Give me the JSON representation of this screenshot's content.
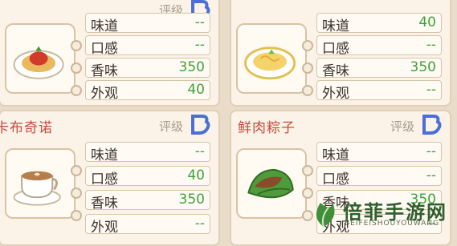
{
  "cards": [
    {
      "name": "",
      "rating_label": "评级",
      "stats": [
        {
          "label": "味道",
          "value": "--"
        },
        {
          "label": "口感",
          "value": "--"
        },
        {
          "label": "香味",
          "value": "350"
        },
        {
          "label": "外观",
          "value": "40"
        }
      ],
      "dish_icon": "spaghetti-dish-icon"
    },
    {
      "name": "",
      "rating_label": "",
      "stats": [
        {
          "label": "味道",
          "value": "40"
        },
        {
          "label": "口感",
          "value": "--"
        },
        {
          "label": "香味",
          "value": "350"
        },
        {
          "label": "外观",
          "value": "--"
        }
      ],
      "dish_icon": "pasta-plate-icon"
    },
    {
      "name": "卡布奇诺",
      "rating_label": "评级",
      "stats": [
        {
          "label": "味道",
          "value": "--"
        },
        {
          "label": "口感",
          "value": "40"
        },
        {
          "label": "香味",
          "value": "350"
        },
        {
          "label": "外观",
          "value": "--"
        }
      ],
      "dish_icon": "coffee-cup-icon"
    },
    {
      "name": "鲜肉粽子",
      "rating_label": "评级",
      "stats": [
        {
          "label": "味道",
          "value": "--"
        },
        {
          "label": "口感",
          "value": "--"
        },
        {
          "label": "香味",
          "value": "350"
        },
        {
          "label": "外观",
          "value": "--"
        }
      ],
      "dish_icon": "zongzi-icon"
    }
  ],
  "watermark": {
    "title": "倍菲手游网",
    "subtitle": "BEIFEISHOUYOUWANG"
  },
  "colors": {
    "value_green": "#3ca33a",
    "title_red": "#c8493a",
    "grade_blue": "#4a6fd8"
  }
}
